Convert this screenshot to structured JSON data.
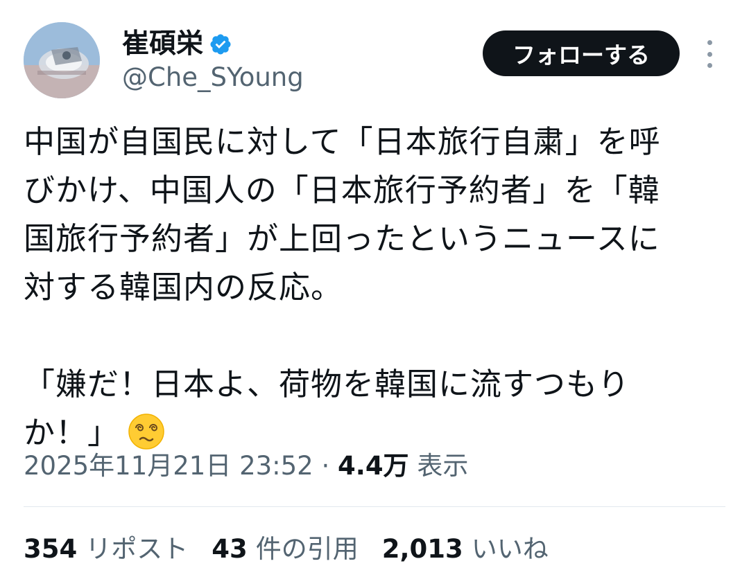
{
  "author": {
    "display_name": "崔碩栄",
    "handle": "@Che_SYoung",
    "verified_icon": "verified-badge-icon",
    "verified_color": "#1d9bf0"
  },
  "header": {
    "follow_label": "フォローする",
    "more_icon": "more-vertical-icon"
  },
  "tweet": {
    "lines": [
      "中国が自国民に対して「日本旅行自粛」を呼",
      "びかけ、中国人の「日本旅行予約者」を「韓",
      "国旅行予約者」が上回ったというニュースに",
      "対する韓国内の反応。"
    ],
    "quote_lines": [
      "「嫌だ！日本よ、荷物を韓国に流すつもり",
      "か！」"
    ],
    "emoji": "dizzy-face-emoji-icon"
  },
  "meta": {
    "timestamp": "2025年11月21日 23:52",
    "separator": "·",
    "views_count": "4.4万",
    "views_label": "表示"
  },
  "stats": {
    "reposts_count": "354",
    "reposts_label": "リポスト",
    "quotes_count": "43",
    "quotes_label": "件の引用",
    "likes_count": "2,013",
    "likes_label": "いいね"
  },
  "colors": {
    "text": "#0f1419",
    "secondary": "#536471",
    "button_bg": "#0f1419",
    "divider": "#e1e8ed"
  }
}
